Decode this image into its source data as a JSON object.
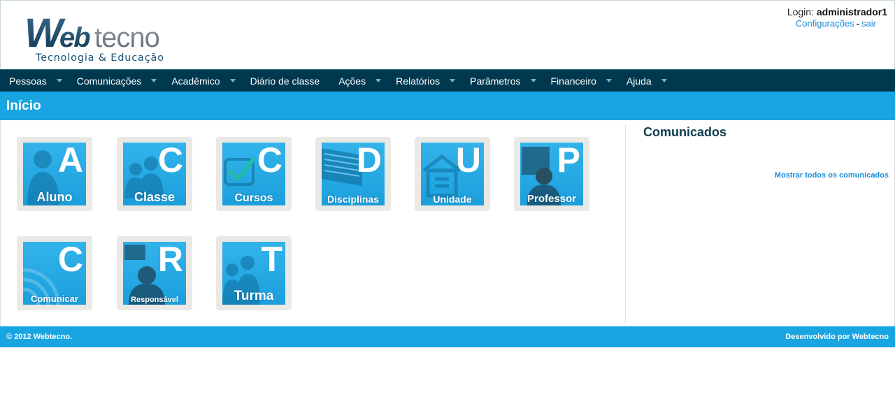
{
  "header": {
    "logo": {
      "brand": "Webtecno",
      "tagline": "Tecnologia & Educação"
    },
    "login_label": "Login:",
    "username": "administrador1",
    "settings_link": "Configurações",
    "separator": "-",
    "logout_link": "sair"
  },
  "menu": [
    {
      "label": "Pessoas",
      "dropdown": true
    },
    {
      "label": "Comunicações",
      "dropdown": true
    },
    {
      "label": "Acadêmico",
      "dropdown": true
    },
    {
      "label": "Diário de classe",
      "dropdown": false
    },
    {
      "label": "Ações",
      "dropdown": true
    },
    {
      "label": "Relatórios",
      "dropdown": true
    },
    {
      "label": "Parâmetros",
      "dropdown": true
    },
    {
      "label": "Financeiro",
      "dropdown": true
    },
    {
      "label": "Ajuda",
      "dropdown": true
    }
  ],
  "page_title": "Início",
  "tiles": [
    {
      "letter": "A",
      "caption": "Aluno",
      "icon": "student-icon"
    },
    {
      "letter": "C",
      "caption": "Classe",
      "icon": "class-icon"
    },
    {
      "letter": "C",
      "caption": "Cursos",
      "icon": "courses-icon"
    },
    {
      "letter": "D",
      "caption": "Disciplinas",
      "icon": "subjects-icon"
    },
    {
      "letter": "U",
      "caption": "Unidade",
      "icon": "unit-icon"
    },
    {
      "letter": "P",
      "caption": "Professor",
      "icon": "teacher-icon"
    },
    {
      "letter": "C",
      "caption": "Comunicar",
      "icon": "communicate-icon"
    },
    {
      "letter": "R",
      "caption": "Responsável",
      "icon": "guardian-icon"
    },
    {
      "letter": "T",
      "caption": "Turma",
      "icon": "group-icon"
    }
  ],
  "sidebar": {
    "title": "Comunicados",
    "show_all_link": "Mostrar todos os comunicados"
  },
  "footer": {
    "copyright": "© 2012 Webtecno.",
    "developer": "Desenvolvido por Webtecno"
  },
  "colors": {
    "nav_bg": "#00394f",
    "accent": "#19a5e1",
    "link": "#1a8ed6",
    "heading": "#0e3c51"
  }
}
